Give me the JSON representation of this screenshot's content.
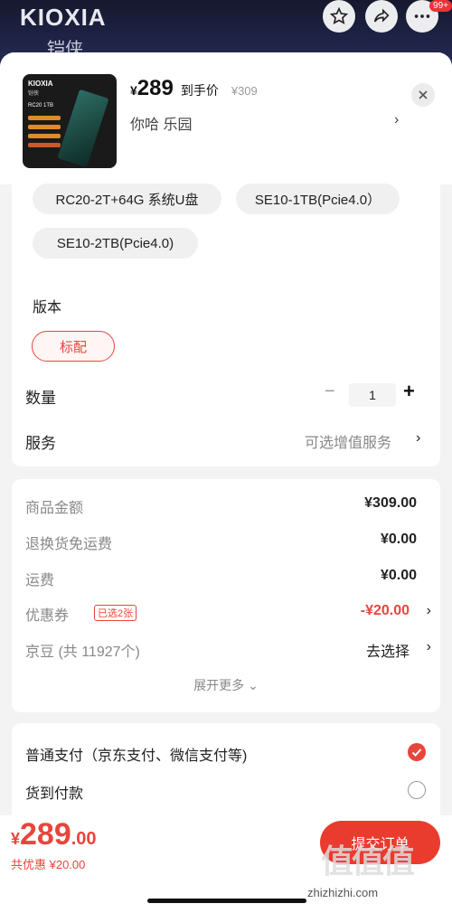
{
  "header": {
    "brand": "KIOXIA",
    "brand_sub": "铠侠",
    "notif_badge": "99+",
    "icons": [
      "star-icon",
      "share-icon",
      "more-icon"
    ]
  },
  "product": {
    "thumb": {
      "logo": "KIOXIA",
      "sub": "铠侠",
      "label": "RC20 1TB"
    },
    "price_symbol": "¥",
    "price": "289",
    "price_tag": "到手价",
    "original_price": "¥309",
    "selected": "你哈  乐园",
    "arrow": "›"
  },
  "options": {
    "chips": [
      "RC20-2T+64G 系统U盘",
      "SE10-1TB(Pcie4.0）",
      "SE10-2TB(Pcie4.0)"
    ],
    "version_label": "版本",
    "version_chip": "标配",
    "quantity_label": "数量",
    "quantity_minus": "−",
    "quantity_value": "1",
    "quantity_plus": "+",
    "service_label": "服务",
    "service_value": "可选增值服务",
    "service_arrow": "›"
  },
  "fees": {
    "rows": [
      {
        "k": "商品金额",
        "v": "¥309.00"
      },
      {
        "k": "退换货免运费",
        "v": "¥0.00"
      },
      {
        "k": "运费",
        "v": "¥0.00"
      },
      {
        "k": "优惠券",
        "badge": "已选2张",
        "v": "-¥20.00",
        "arrow": "›"
      },
      {
        "k": "京豆 (共 11927个)",
        "v": "去选择",
        "arrow": "›"
      }
    ],
    "expand": "展开更多 ⌄"
  },
  "payment": {
    "options": [
      {
        "label": "普通支付（京东支付、微信支付等)",
        "selected": true
      },
      {
        "label": "货到付款",
        "selected": false
      }
    ]
  },
  "bottom": {
    "total_symbol": "¥",
    "total_int": "289",
    "total_dec": ".00",
    "discount": "共优惠 ¥20.00",
    "submit": "提交订单",
    "wm_logo": "值值值",
    "watermark": "zhizhizhi.com"
  },
  "colors": {
    "accent": "#e8453c",
    "header_bg": "#1e2140"
  }
}
